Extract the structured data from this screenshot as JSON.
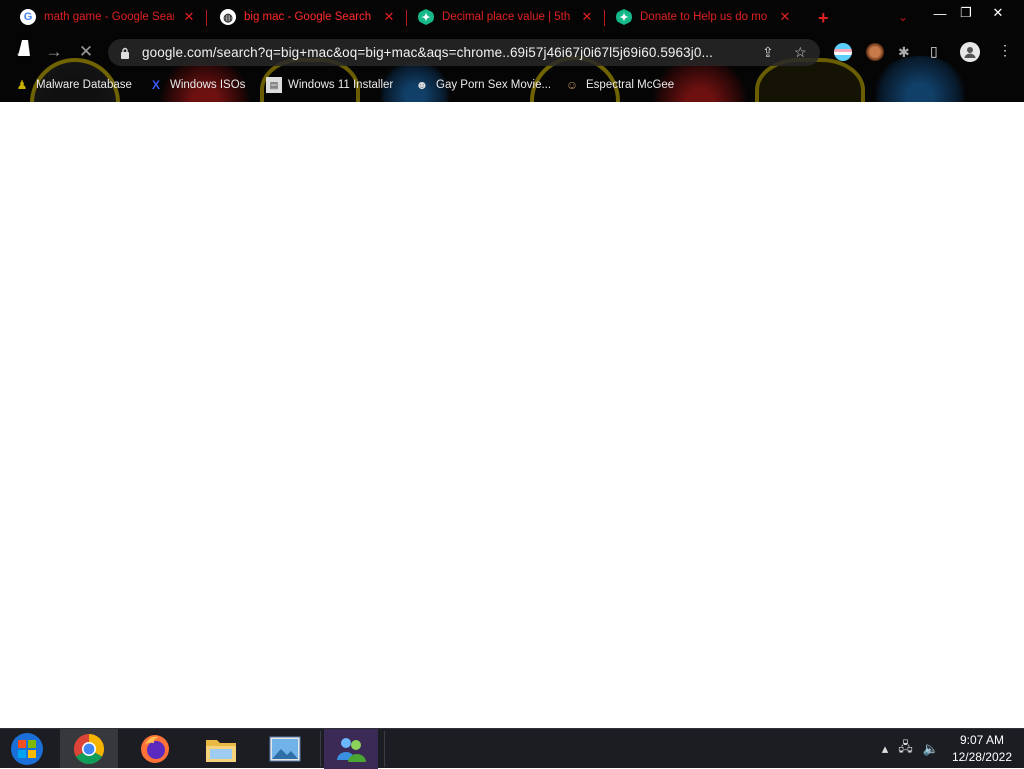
{
  "tabs": [
    {
      "title": "math game - Google Sear",
      "favicon": "google-g-icon",
      "active": false
    },
    {
      "title": "big mac - Google Search",
      "favicon": "loading-icon",
      "active": true
    },
    {
      "title": "Decimal place value | 5th",
      "favicon": "khan-academy-icon",
      "active": false
    },
    {
      "title": "Donate to Help us do mo",
      "favicon": "khan-academy-icon",
      "active": false
    }
  ],
  "toolbar": {
    "url": "google.com/search?q=big+mac&oq=big+mac&aqs=chrome..69i57j46i67j0i67l5j69i60.5963j0..."
  },
  "bookmarks": [
    {
      "label": "Malware Database",
      "icon": "person-icon"
    },
    {
      "label": "Windows ISOs",
      "icon": "x-logo-icon"
    },
    {
      "label": "Windows 11 Installer",
      "icon": "page-icon"
    },
    {
      "label": "Gay Porn Sex Movie...",
      "icon": "avatar-icon"
    },
    {
      "label": "Espectral McGee",
      "icon": "face-icon"
    }
  ],
  "taskbar": {
    "apps": [
      "start-button",
      "chrome",
      "firefox",
      "file-explorer",
      "photo-viewer",
      "messenger"
    ],
    "clock_time": "9:07 AM",
    "clock_date": "12/28/2022"
  },
  "colors": {
    "tab_text": "#e02020",
    "chrome_bg": "#050505",
    "taskbar_bg": "#1b1d22"
  }
}
